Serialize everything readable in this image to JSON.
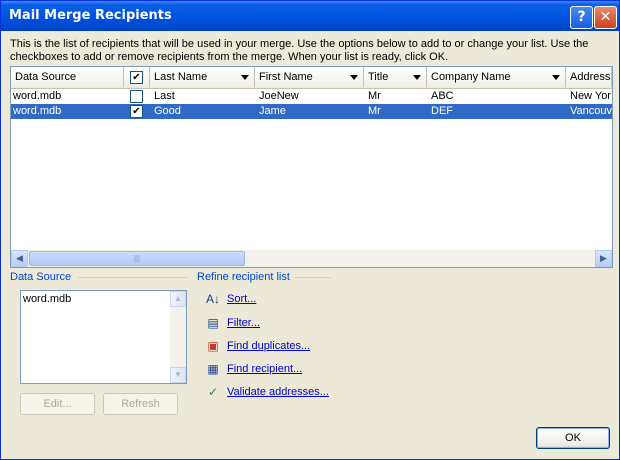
{
  "window": {
    "title": "Mail Merge Recipients",
    "help_glyph": "?",
    "close_glyph": "✕"
  },
  "intro_text": "This is the list of recipients that will be used in your merge.  Use the options below to add to or change your list.  Use the checkboxes to add or remove recipients from the merge.  When your list is ready, click OK.",
  "grid": {
    "columns": [
      "Data Source",
      "",
      "Last Name",
      "First Name",
      "Title",
      "Company Name",
      "Address"
    ],
    "rows": [
      {
        "source": "word.mdb",
        "checked": "",
        "last": "Last",
        "first": "JoeNew",
        "title": "Mr",
        "company": "ABC",
        "address": "New Yor"
      },
      {
        "source": "word.mdb",
        "checked": "✔",
        "last": "Good",
        "first": "Jame",
        "title": "Mr",
        "company": "DEF",
        "address": "Vancouv"
      }
    ],
    "header_check": "✔",
    "scroll_left": "◀",
    "scroll_right": "▶",
    "thumb_grip": "|||"
  },
  "data_source": {
    "label": "Data Source",
    "items": [
      "word.mdb"
    ],
    "scroll_up": "▲",
    "scroll_down": "▼",
    "edit_label": "Edit...",
    "refresh_label": "Refresh"
  },
  "refine": {
    "label": "Refine recipient list",
    "links": [
      "Sort...",
      "Filter...",
      "Find duplicates...",
      "Find recipient...",
      "Validate addresses..."
    ],
    "icons": [
      "sort-icon",
      "filter-icon",
      "duplicates-icon",
      "find-icon",
      "validate-icon"
    ],
    "icon_glyphs": [
      "A↓",
      "▤",
      "▣",
      "▦",
      "✓"
    ]
  },
  "ok_label": "OK",
  "colors": {
    "accent": "#0054e3",
    "selection": "#316ac5",
    "link": "#0000cc"
  }
}
